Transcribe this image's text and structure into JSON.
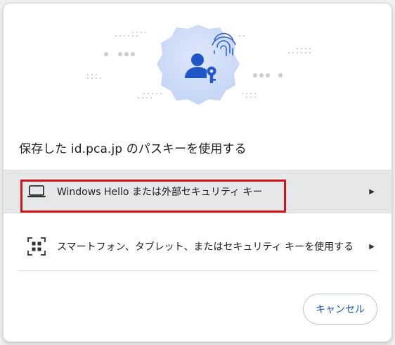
{
  "dialog": {
    "title": "保存した id.pca.jp のパスキーを使用する"
  },
  "options": [
    {
      "label": "Windows Hello または外部セキュリティ キー",
      "icon": "laptop-icon",
      "arrow": "▶",
      "highlighted": true
    },
    {
      "label": "スマートフォン、タブレット、またはセキュリティ キーを使用する",
      "icon": "qr-code-icon",
      "arrow": "▶",
      "highlighted": false
    }
  ],
  "buttons": {
    "cancel_label": "キャンセル"
  },
  "colors": {
    "accent": "#1a56c4",
    "highlight_border": "#d0151a",
    "selected_row": "#e6e7e9",
    "hero_icon": "#1f57c9"
  },
  "hero": {
    "icons": [
      "person-key-icon",
      "fingerprint-icon"
    ]
  }
}
